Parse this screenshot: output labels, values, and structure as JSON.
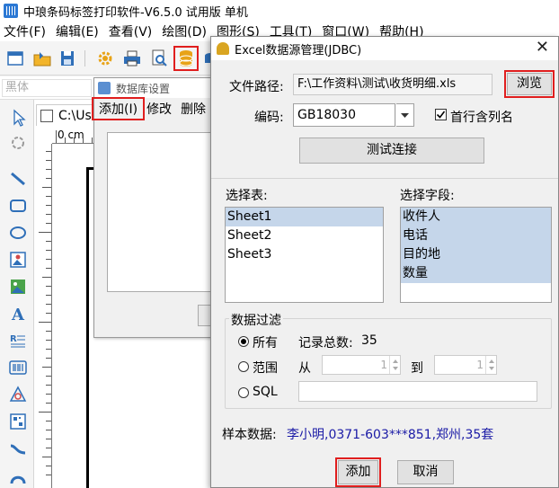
{
  "app": {
    "title": "中琅条码标签打印软件-V6.5.0 试用版 单机"
  },
  "menubar": [
    "文件(F)",
    "编辑(E)",
    "查看(V)",
    "绘图(D)",
    "图形(S)",
    "工具(T)",
    "窗口(W)",
    "帮助(H)"
  ],
  "fontbar": {
    "font_name": "黑体"
  },
  "document": {
    "tab_label": "C:\\Use",
    "ruler_label": "0 cm"
  },
  "db_dialog": {
    "title": "数据库设置",
    "menu": [
      "添加(I)",
      "修改",
      "删除"
    ]
  },
  "excel_dialog": {
    "title": "Excel数据源管理(JDBC)",
    "close_glyph": "✕",
    "file_path_label": "文件路径:",
    "file_path_value": "F:\\工作资料\\测试\\收货明细.xls",
    "browse_button": "浏览",
    "encoding_label": "编码:",
    "encoding_value": "GB18030",
    "header_checkbox_label": "首行含列名",
    "header_checkbox_checked": true,
    "test_connection_button": "测试连接",
    "select_table_label": "选择表:",
    "tables": [
      "Sheet1",
      "Sheet2",
      "Sheet3"
    ],
    "selected_table": "Sheet1",
    "select_fields_label": "选择字段:",
    "fields": [
      "收件人",
      "电话",
      "目的地",
      "数量"
    ],
    "filter": {
      "group_label": "数据过滤",
      "all_label": "所有",
      "record_count_label": "记录总数:",
      "record_count": "35",
      "range_label": "范围",
      "from_label": "从",
      "from_value": "1",
      "to_label": "到",
      "to_value": "1",
      "sql_label": "SQL",
      "sql_value": ""
    },
    "sample_label": "样本数据:",
    "sample_value": "李小明,0371-603***851,郑州,35套",
    "add_button": "添加",
    "cancel_button": "取消"
  },
  "colors": {
    "highlight_box": "#e01e1e",
    "selection": "#c5d6ea",
    "sample_text": "#1a1aa6"
  }
}
